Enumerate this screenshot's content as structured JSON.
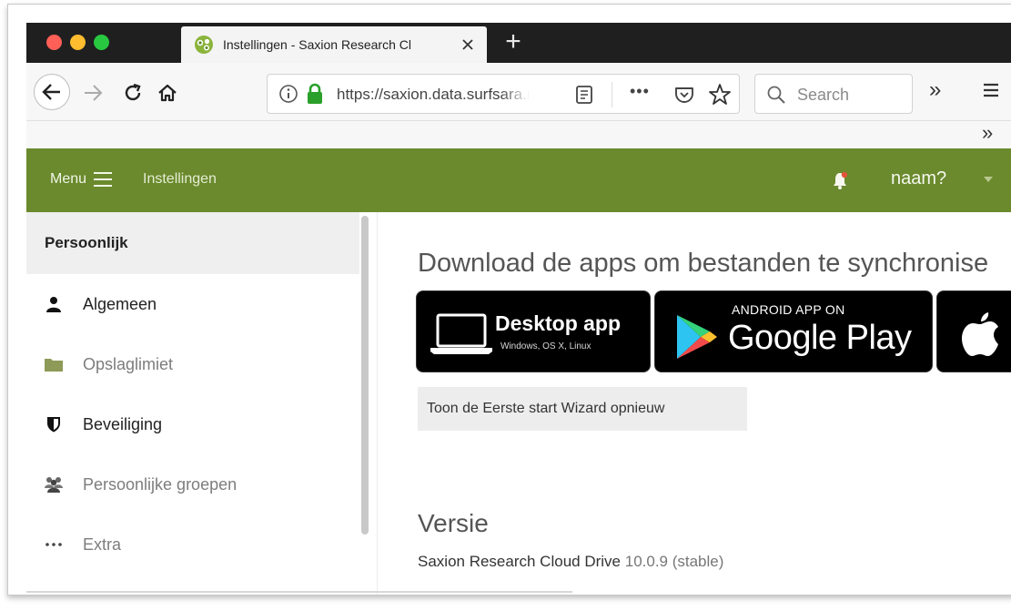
{
  "browser": {
    "tab_title": "Instellingen - Saxion Research Cl",
    "url": "https://saxion.data.surfsara.nl",
    "search_placeholder": "Search",
    "new_tab_symbol": "+",
    "more_actions": "•••",
    "overflow_symbol": "»"
  },
  "app": {
    "menu_label": "Menu",
    "breadcrumb": "Instellingen",
    "username": "naam?",
    "accent_color": "#6a8a2d"
  },
  "sidebar": {
    "header": "Persoonlijk",
    "items": [
      {
        "label": "Algemeen",
        "icon": "user-icon",
        "muted": false
      },
      {
        "label": "Opslaglimiet",
        "icon": "folder-icon",
        "muted": true
      },
      {
        "label": "Beveiliging",
        "icon": "shield-icon",
        "muted": false
      },
      {
        "label": "Persoonlijke groepen",
        "icon": "group-icon",
        "muted": true
      },
      {
        "label": "Extra",
        "icon": "more-icon",
        "muted": true
      }
    ]
  },
  "main": {
    "download_title": "Download de apps om bestanden te synchronise",
    "desktop_badge": {
      "main": "Desktop app",
      "sub": "Windows, OS X, Linux"
    },
    "google_badge": {
      "small": "ANDROID APP ON",
      "big": "Google Play"
    },
    "wizard_button": "Toon de Eerste start Wizard opnieuw",
    "version_title": "Versie",
    "product_name": "Saxion Research Cloud Drive",
    "version_number": "10.0.9 (stable)"
  }
}
